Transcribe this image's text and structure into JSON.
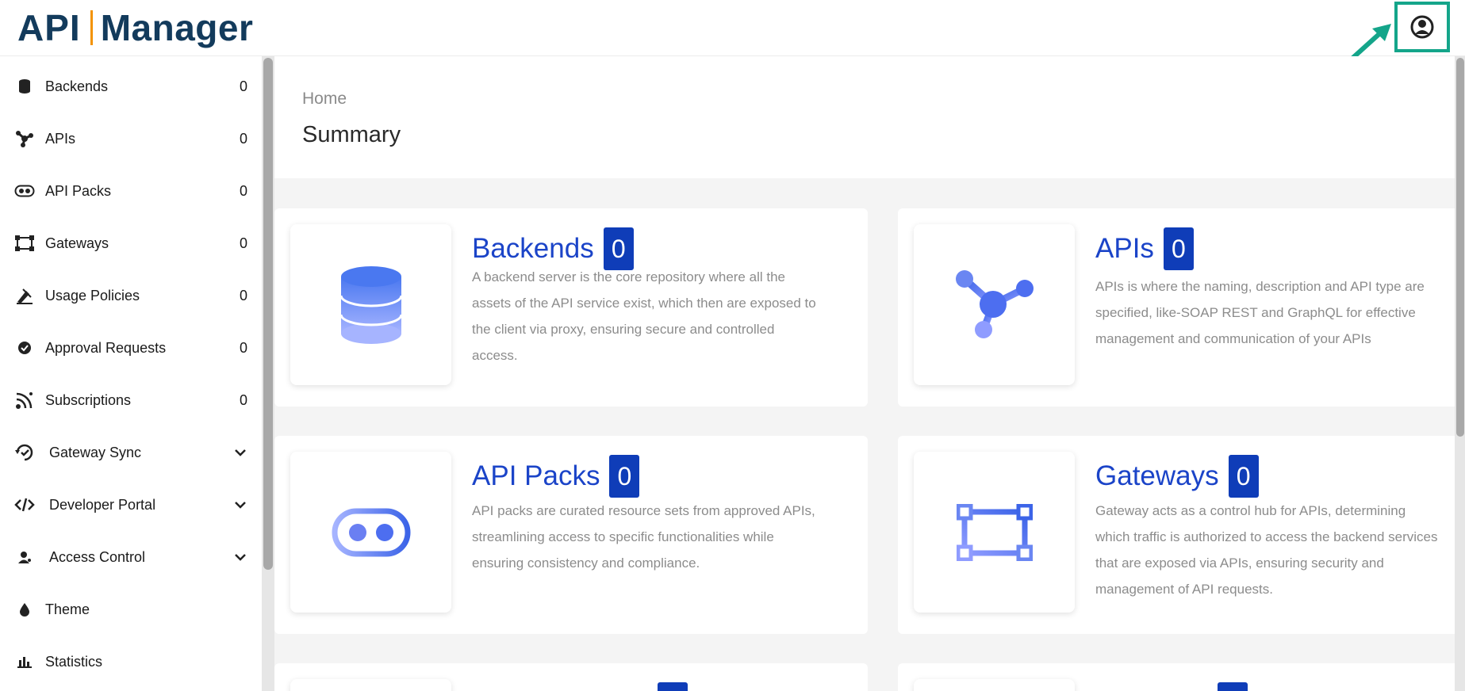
{
  "app": {
    "logo_left": "API",
    "logo_right": "Manager"
  },
  "header": {
    "user_icon": "user-circle-icon",
    "accent": "#14a58a"
  },
  "sidebar": {
    "items": [
      {
        "label": "Backends",
        "count": "0",
        "icon": "database-icon"
      },
      {
        "label": "APIs",
        "count": "0",
        "icon": "api-nodes-icon"
      },
      {
        "label": "API Packs",
        "count": "0",
        "icon": "pack-icon"
      },
      {
        "label": "Gateways",
        "count": "0",
        "icon": "gateway-icon"
      },
      {
        "label": "Usage Policies",
        "count": "0",
        "icon": "policy-icon"
      },
      {
        "label": "Approval Requests",
        "count": "0",
        "icon": "approval-icon"
      },
      {
        "label": "Subscriptions",
        "count": "0",
        "icon": "subscription-icon"
      },
      {
        "label": "Gateway Sync",
        "icon": "sync-icon"
      },
      {
        "label": "Developer Portal",
        "icon": "code-icon"
      },
      {
        "label": "Access Control",
        "icon": "access-icon"
      },
      {
        "label": "Theme",
        "icon": "drop-icon"
      },
      {
        "label": "Statistics",
        "icon": "bar-chart-icon"
      }
    ]
  },
  "main": {
    "breadcrumb": "Home",
    "title": "Summary",
    "cards": [
      {
        "title": "Backends",
        "count": "0",
        "desc": "A backend server is the core repository where all the assets of the API service exist, which then are exposed to the client via proxy, ensuring secure and controlled access."
      },
      {
        "title": "APIs",
        "count": "0",
        "desc": "APIs is where the naming, description and API type are specified, like-SOAP REST and GraphQL for effective management and communication of your APIs"
      },
      {
        "title": "API Packs",
        "count": "0",
        "desc": "API packs are curated resource sets from approved APIs, streamlining access to specific functionalities while ensuring consistency and compliance."
      },
      {
        "title": "Gateways",
        "count": "0",
        "desc": "Gateway acts as a control hub for APIs, determining which traffic is authorized to access the backend services that are exposed via APIs, ensuring security and management of API requests."
      }
    ]
  }
}
